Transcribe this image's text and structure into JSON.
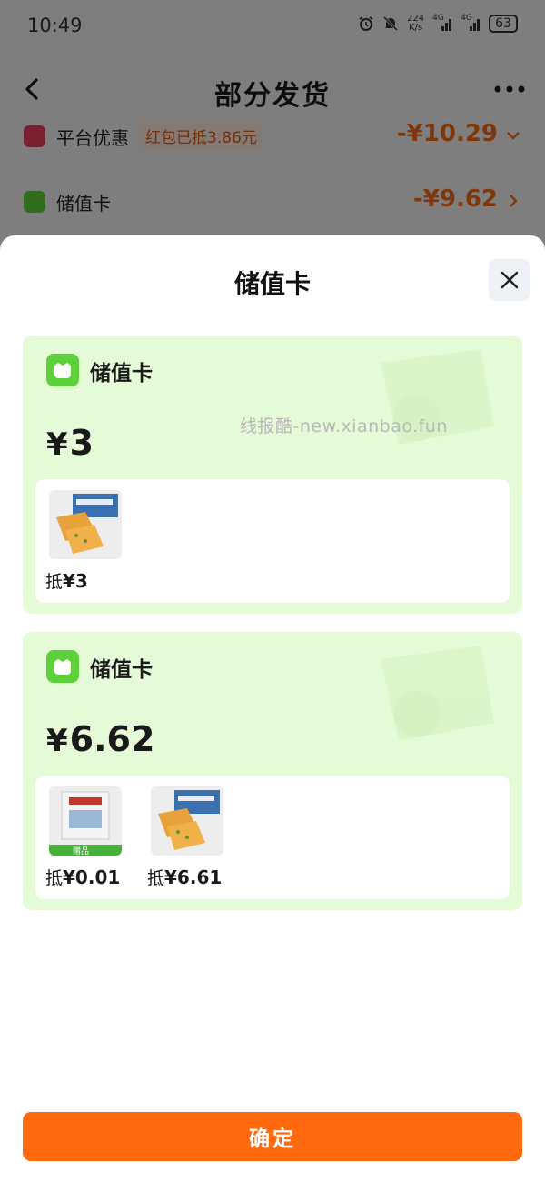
{
  "status_bar": {
    "time": "10:49",
    "net_speed_top": "224",
    "net_speed_bottom": "K/s",
    "sig1_label": "4G",
    "sig2_label": "4G",
    "battery": "63"
  },
  "header": {
    "title": "部分发货"
  },
  "background_rows": [
    {
      "label": "平台优惠",
      "tag": "红包已抵3.86元",
      "amount": "-¥10.29",
      "icon_color": "#e63e5c"
    },
    {
      "label": "储值卡",
      "amount": "-¥9.62",
      "icon_color": "#5ed13a"
    }
  ],
  "sheet": {
    "title": "储值卡",
    "watermark": "线报酷-new.xianbao.fun",
    "cards": [
      {
        "name": "储值卡",
        "currency": "¥",
        "amount": "3",
        "products": [
          {
            "image": "biscuit-product",
            "deduct_prefix": "抵",
            "deduct_value": "¥3"
          }
        ]
      },
      {
        "name": "储值卡",
        "currency": "¥",
        "amount": "6.62",
        "products": [
          {
            "image": "pet-food-product",
            "badge": "赠品",
            "deduct_prefix": "抵",
            "deduct_value": "¥0.01"
          },
          {
            "image": "biscuit-product",
            "deduct_prefix": "抵",
            "deduct_value": "¥6.61"
          }
        ]
      }
    ],
    "confirm_label": "确定"
  },
  "colors": {
    "accent_orange": "#ff6a10",
    "card_green": "#e5fad6",
    "card_icon_green": "#5ed13a"
  }
}
